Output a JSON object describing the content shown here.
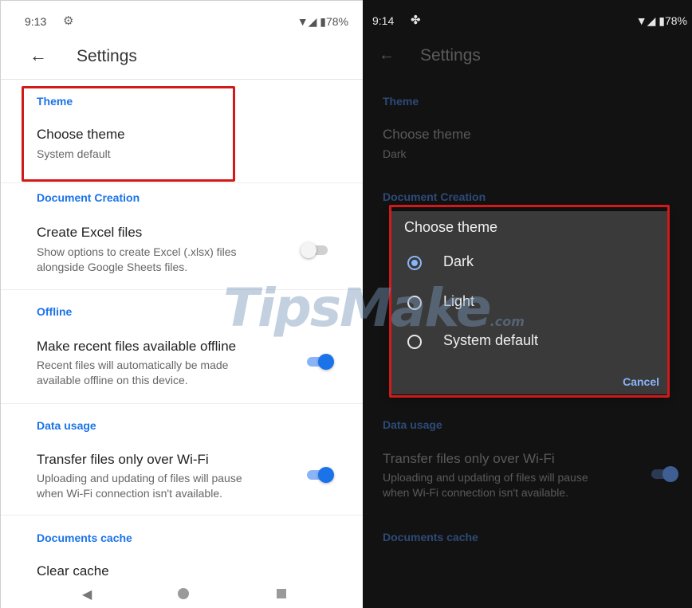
{
  "left": {
    "status": {
      "time": "9:13",
      "battery": "78%"
    },
    "appbar": {
      "title": "Settings"
    },
    "sections": {
      "theme": {
        "header": "Theme",
        "title": "Choose theme",
        "value": "System default"
      },
      "doc_creation": {
        "header": "Document Creation",
        "title": "Create Excel files",
        "desc1": "Show options to create Excel (.xlsx) files",
        "desc2": "alongside Google Sheets files."
      },
      "offline": {
        "header": "Offline",
        "title": "Make recent files available offline",
        "desc1": "Recent files will automatically be made",
        "desc2": "available offline on this device."
      },
      "data_usage": {
        "header": "Data usage",
        "title": "Transfer files only over Wi-Fi",
        "desc1": "Uploading and updating of files will pause",
        "desc2": "when Wi-Fi connection isn't available."
      },
      "cache": {
        "header": "Documents cache",
        "title": "Clear cache"
      }
    },
    "toggles": {
      "excel": false,
      "offline": true,
      "wifi": true
    }
  },
  "right": {
    "status": {
      "time": "9:14",
      "battery": "78%"
    },
    "appbar": {
      "title": "Settings"
    },
    "theme": {
      "header": "Theme",
      "title": "Choose theme",
      "value": "Dark"
    },
    "doc_creation_header": "Document Creation",
    "data_usage": {
      "header": "Data usage",
      "title": "Transfer files only over Wi-Fi",
      "desc1": "Uploading and updating of files will pause",
      "desc2": "when Wi-Fi connection isn't available."
    },
    "cache_header": "Documents cache",
    "dialog": {
      "title": "Choose theme",
      "options": [
        "Dark",
        "Light",
        "System default"
      ],
      "selected": "Dark",
      "cancel": "Cancel"
    }
  },
  "watermark": {
    "main": "TipsMake",
    "suffix": ".com"
  },
  "colors": {
    "accent": "#1a73e8",
    "dark_accent": "#8ab4f8",
    "highlight": "#d21a1a"
  }
}
